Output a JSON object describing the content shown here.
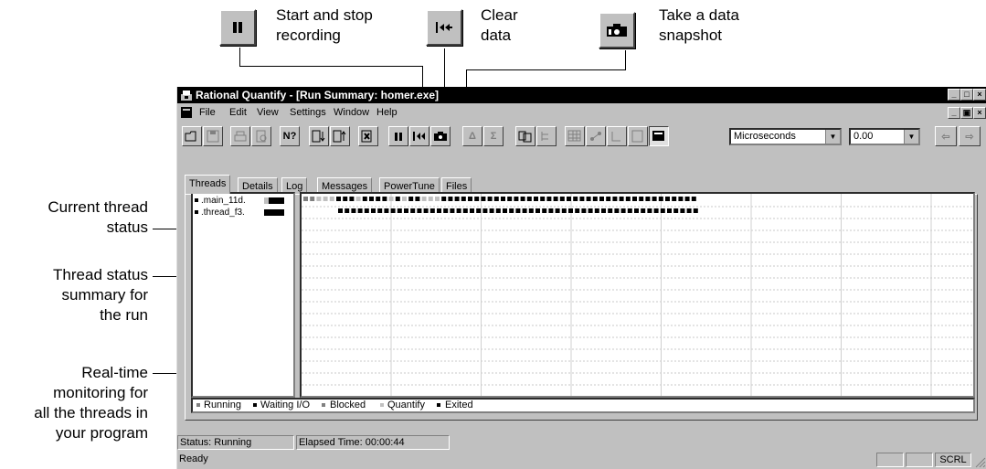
{
  "callouts": {
    "start_stop": "Start and stop\nrecording",
    "clear": "Clear\ndata",
    "snapshot": "Take a data\nsnapshot",
    "current_thread": "Current thread\nstatus",
    "thread_summary": "Thread status\nsummary for\nthe run",
    "realtime": "Real-time\nmonitoring for\nall the threads in\nyour program"
  },
  "window": {
    "title": "Rational Quantify - [Run Summary: homer.exe]",
    "menu": [
      "File",
      "Edit",
      "View",
      "Settings",
      "Window",
      "Help"
    ]
  },
  "toolbar": {
    "units": "Microseconds",
    "value": "0.00"
  },
  "tabs": [
    "Threads",
    "Details",
    "Log",
    "Messages",
    "PowerTune",
    "Files"
  ],
  "threads": [
    ".main_11d.",
    ".thread_f3."
  ],
  "legend": [
    "Running",
    "Waiting I/O",
    "Blocked",
    "Quantify",
    "Exited"
  ],
  "colors": {
    "running": "#808080",
    "waiting": "#000000",
    "blocked": "#808080",
    "quantify": "#c0c0c0",
    "exited": "#000000"
  },
  "status": {
    "state": "Status: Running",
    "elapsed": "Elapsed Time: 00:00:44",
    "ready": "Ready",
    "scrl": "SCRL"
  }
}
